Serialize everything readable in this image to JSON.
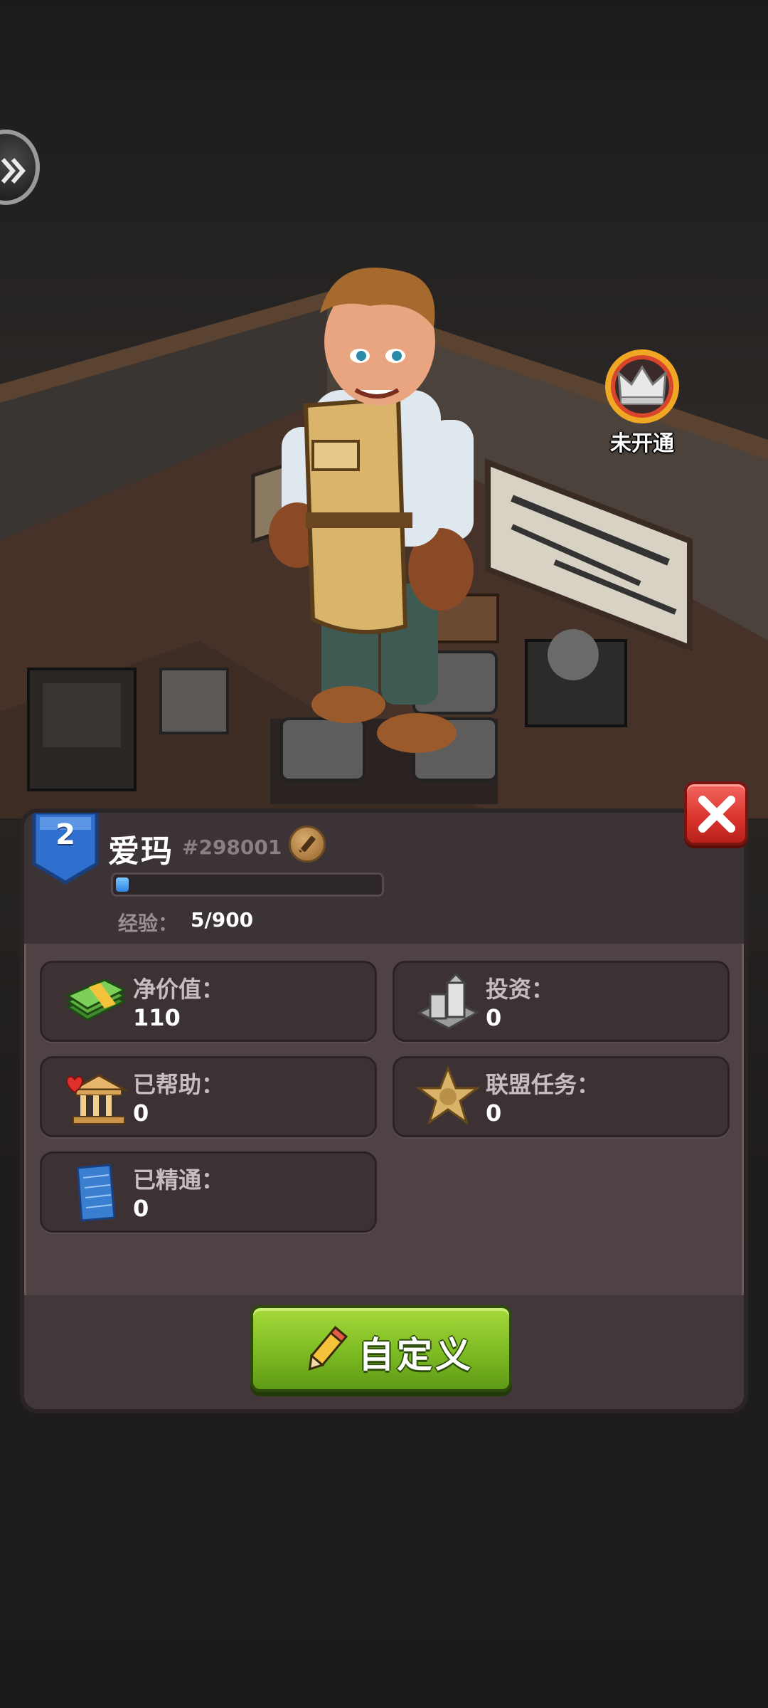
{
  "hud": {
    "crown_badge_label": "未开通"
  },
  "profile": {
    "level": "2",
    "name": "爱玛",
    "player_id": "#298001",
    "xp_label": "经验：",
    "xp_value": "5/900",
    "xp_progress": 0.0056
  },
  "stats": [
    {
      "label": "净价值：",
      "value": "110",
      "icon": "cash-stack-icon"
    },
    {
      "label": "投资：",
      "value": "0",
      "icon": "building-investment-icon"
    },
    {
      "label": "已帮助：",
      "value": "0",
      "icon": "bank-heart-icon"
    },
    {
      "label": "联盟任务：",
      "value": "0",
      "icon": "sheriff-star-icon"
    },
    {
      "label": "已精通：",
      "value": "0",
      "icon": "blueprint-icon"
    }
  ],
  "actions": {
    "customize_label": "自定义"
  },
  "colors": {
    "panel": "#4e4244",
    "button_green": "#7cbb22",
    "close_red": "#d9322b",
    "xp_blue": "#2d86e0",
    "level_badge": "#2f6fce"
  }
}
